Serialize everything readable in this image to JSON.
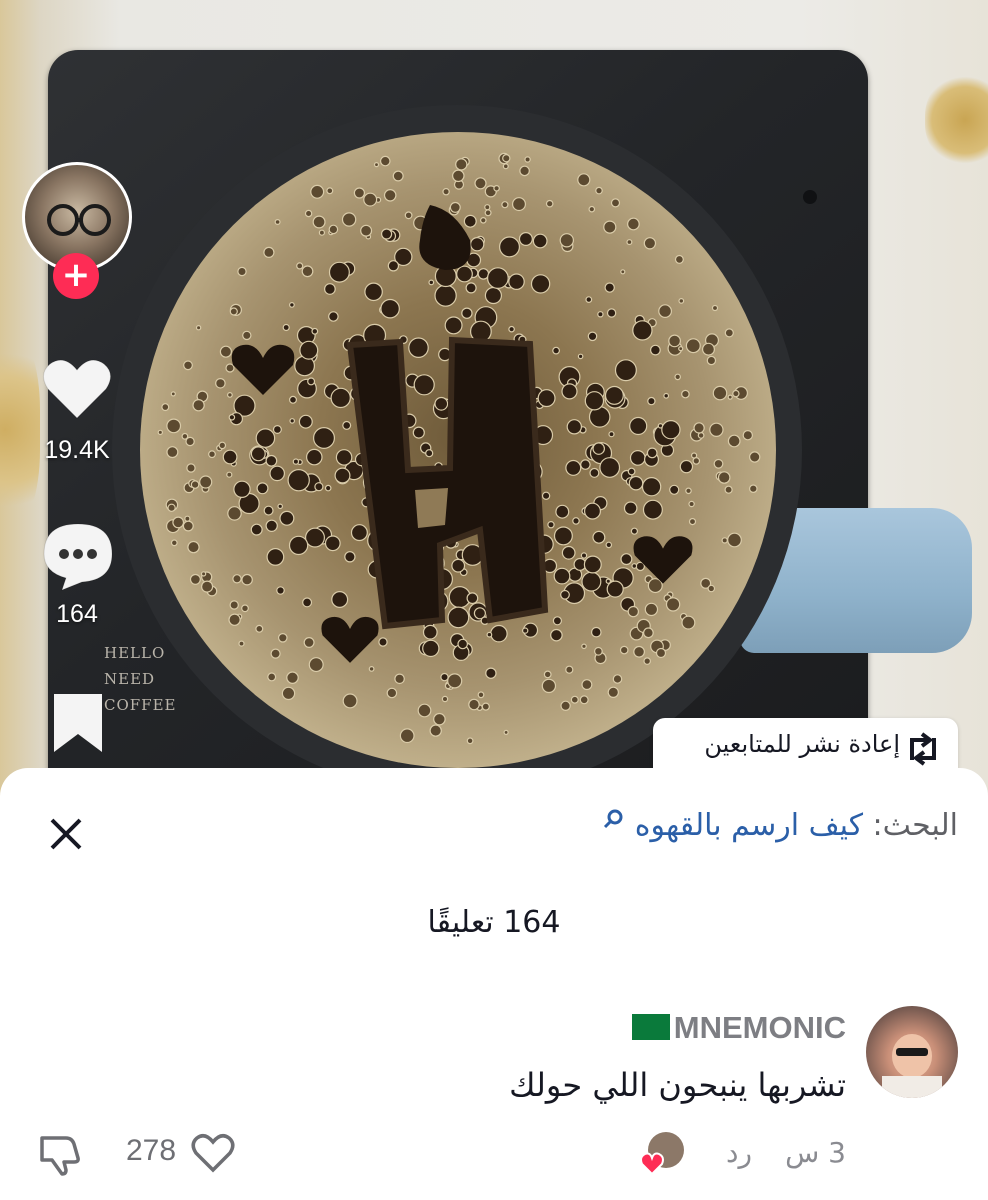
{
  "video": {
    "mug_label_lines": [
      "HELLO",
      "NEED",
      "COFFEE"
    ]
  },
  "rail": {
    "likes_count": "19.4K",
    "comments_count": "164",
    "repost_label": "إعادة نشر للمتابعين"
  },
  "sheet": {
    "search_label": "البحث:",
    "search_query": "كيف ارسم بالقهوه",
    "comments_title": "164 تعليقًا"
  },
  "comment": {
    "username": "MNEMONIC",
    "text": "تشربها ينبحون اللي حولك",
    "time": "3 س",
    "reply_label": "رد",
    "like_count": "278"
  },
  "colors": {
    "accent": "#fe2c55",
    "search_link": "#2b5fa8",
    "muted_text": "#8a8b91"
  }
}
